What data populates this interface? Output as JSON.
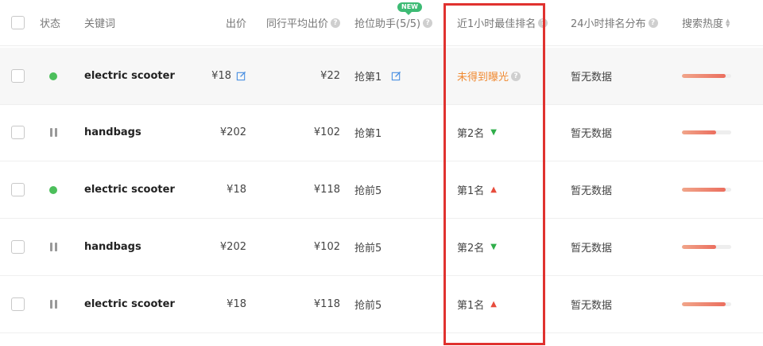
{
  "header": {
    "status": "状态",
    "keyword": "关键词",
    "bid": "出价",
    "avg_bid": "同行平均出价",
    "grab_assistant": "抢位助手(5/5)",
    "new_badge": "NEW",
    "best_rank_1h": "近1小时最佳排名",
    "rank_dist_24h": "24小时排名分布",
    "search_heat": "搜索热度"
  },
  "rows": [
    {
      "status": "active",
      "keyword": "electric scooter",
      "bid": "¥18",
      "avg_bid": "¥22",
      "grab": "抢第1",
      "rank": "未得到曝光",
      "rank_trend": "none",
      "dist": "暂无数据",
      "heat": 0.88,
      "highlight": true
    },
    {
      "status": "paused",
      "keyword": "handbags",
      "bid": "¥202",
      "avg_bid": "¥102",
      "grab": "抢第1",
      "rank": "第2名",
      "rank_trend": "down",
      "dist": "暂无数据",
      "heat": 0.7
    },
    {
      "status": "active",
      "keyword": "electric scooter",
      "bid": "¥18",
      "avg_bid": "¥118",
      "grab": "抢前5",
      "rank": "第1名",
      "rank_trend": "up",
      "dist": "暂无数据",
      "heat": 0.88
    },
    {
      "status": "paused",
      "keyword": "handbags",
      "bid": "¥202",
      "avg_bid": "¥102",
      "grab": "抢前5",
      "rank": "第2名",
      "rank_trend": "down",
      "dist": "暂无数据",
      "heat": 0.7
    },
    {
      "status": "paused",
      "keyword": "electric scooter",
      "bid": "¥18",
      "avg_bid": "¥118",
      "grab": "抢前5",
      "rank": "第1名",
      "rank_trend": "up",
      "dist": "暂无数据",
      "heat": 0.88
    }
  ],
  "colors": {
    "active_dot": "#4cbf5b",
    "rank_up": "#e74c3c",
    "rank_down": "#2fae4a",
    "no_exposure": "#f08a32",
    "highlight_border": "#e0322f",
    "edit_icon": "#4a90e2"
  },
  "icons": {
    "help": "question-circle-icon",
    "sort": "sort-icon",
    "edit": "edit-icon",
    "up": "arrow-up-icon",
    "down": "arrow-down-icon",
    "pause": "pause-icon"
  }
}
